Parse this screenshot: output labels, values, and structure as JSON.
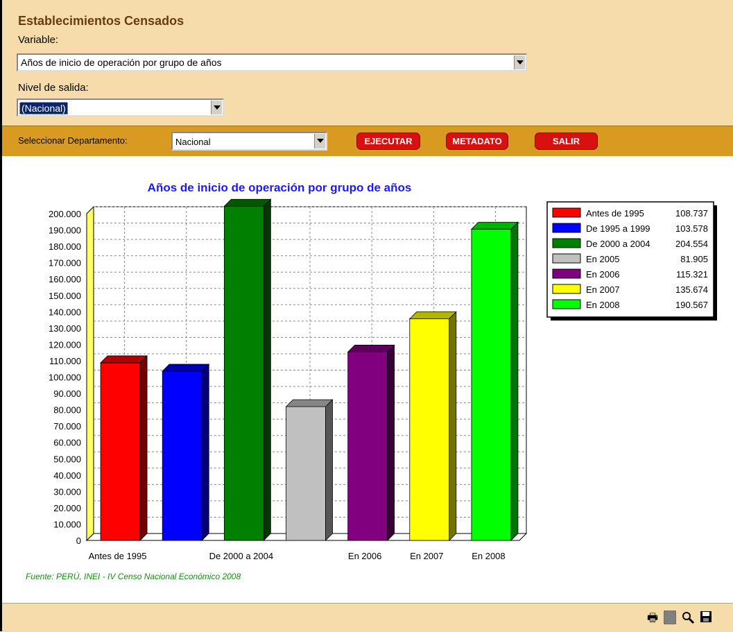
{
  "header": {
    "title": "Establecimientos Censados",
    "variable_label": "Variable:",
    "variable_value": "Años de inicio de operación por grupo de años",
    "nivel_label": "Nivel de salida:",
    "nivel_value": "(Nacional)"
  },
  "toolbar": {
    "departamento_label": "Seleccionar Departamento:",
    "departamento_value": "Nacional",
    "ejecutar_label": "EJECUTAR",
    "metadato_label": "METADATO",
    "salir_label": "SALIR"
  },
  "footer": {
    "source": "Fuente: PERÚ, INEI - IV Censo Nacional Económico 2008",
    "icons": [
      "print-icon",
      "calculator-icon",
      "zoom-icon",
      "save-icon"
    ]
  },
  "chart_data": {
    "type": "bar",
    "title": "Años de inicio de operación por grupo de años",
    "categories": [
      "Antes de 1995",
      "De 1995 a 1999",
      "De 2000 a 2004",
      "En 2005",
      "En 2006",
      "En 2007",
      "En 2008"
    ],
    "values": [
      108737,
      103578,
      204554,
      81905,
      115321,
      135674,
      190567
    ],
    "value_labels": [
      "108.737",
      "103.578",
      "204.554",
      "81.905",
      "115.321",
      "135.674",
      "190.567"
    ],
    "colors": [
      "#ff0000",
      "#0000ff",
      "#007f00",
      "#c0c0c0",
      "#800080",
      "#ffff00",
      "#00ff00"
    ],
    "x_tick_labels": [
      "Antes de 1995",
      "",
      "De 2000 a 2004",
      "",
      "En 2006",
      "En 2007",
      "En 2008"
    ],
    "y_ticks": [
      "0",
      "10.000",
      "20.000",
      "30.000",
      "40.000",
      "50.000",
      "60.000",
      "70.000",
      "80.000",
      "90.000",
      "100.000",
      "110.000",
      "120.000",
      "130.000",
      "140.000",
      "150.000",
      "160.000",
      "170.000",
      "180.000",
      "190.000",
      "200.000"
    ],
    "ylim": [
      0,
      200000
    ],
    "grid": true,
    "legend_position": "top-right",
    "style": "3d"
  }
}
